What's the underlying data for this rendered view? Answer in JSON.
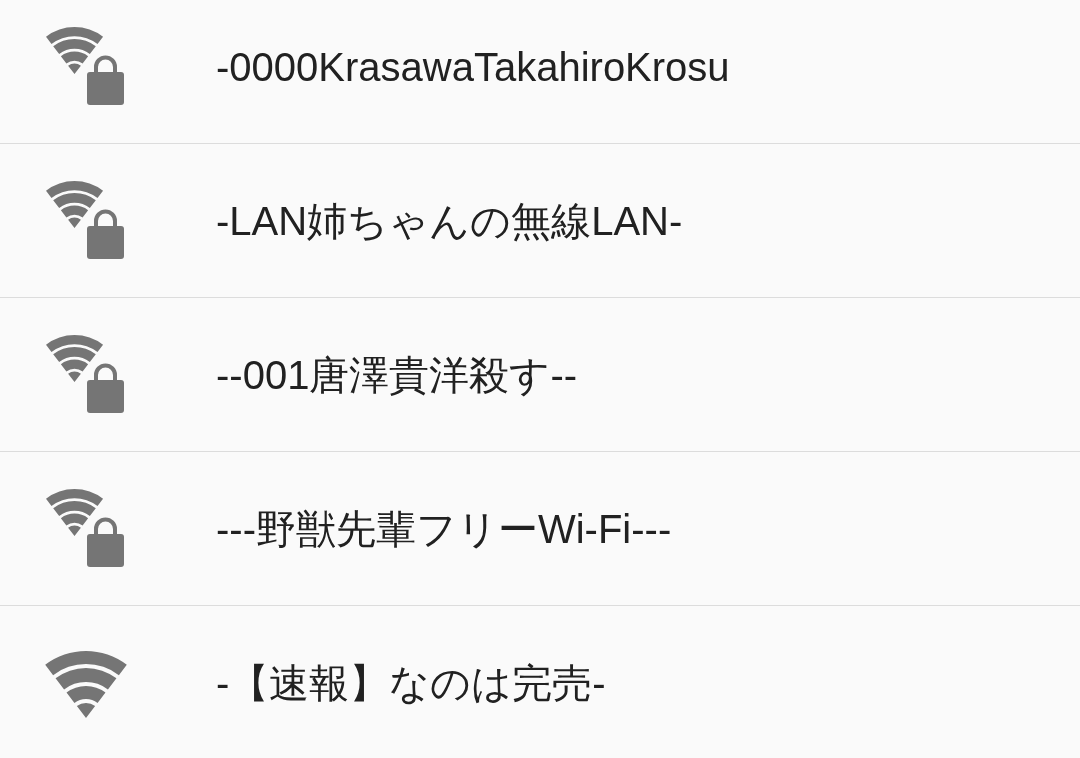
{
  "networks": [
    {
      "name": "-0000KrasawaTakahiroKrosu",
      "secured": true
    },
    {
      "name": "-LAN姉ちゃんの無線LAN-",
      "secured": true
    },
    {
      "name": "--001唐澤貴洋殺す--",
      "secured": true
    },
    {
      "name": "---野獣先輩フリーWi-Fi---",
      "secured": true
    },
    {
      "name": "-【速報】なのは完売-",
      "secured": false
    }
  ]
}
